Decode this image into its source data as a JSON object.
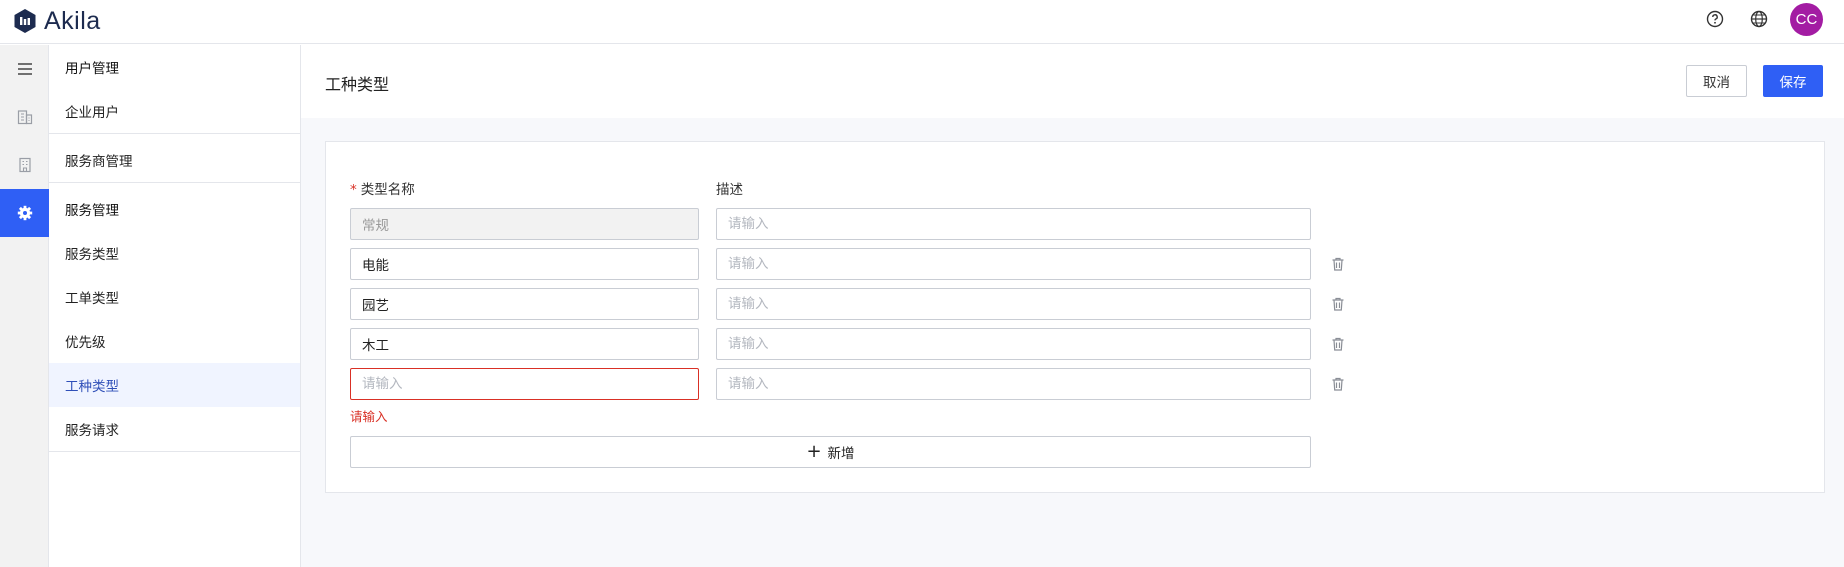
{
  "app": {
    "name": "Akila",
    "avatar_initials": "CC",
    "avatar_color": "#a31ca3",
    "accent": "#2f5ff5"
  },
  "topbar": {
    "icons": [
      "help-icon",
      "globe-icon"
    ]
  },
  "rail": {
    "items": [
      "menu-icon",
      "enterprise-building-icon",
      "building-icon",
      "settings-icon"
    ],
    "active": "settings-icon"
  },
  "sidebar": {
    "groups": [
      {
        "items": [
          "用户管理",
          "企业用户"
        ]
      },
      {
        "items": [
          "服务商管理"
        ]
      },
      {
        "items": [
          "服务管理",
          "服务类型",
          "工单类型",
          "优先级",
          "工种类型",
          "服务请求"
        ]
      }
    ],
    "active": "工种类型"
  },
  "page": {
    "title": "工种类型",
    "cancel_label": "取消",
    "save_label": "保存"
  },
  "form": {
    "name_label": "类型名称",
    "desc_label": "描述",
    "required_mark": "*",
    "rows": [
      {
        "name": "常规",
        "name_placeholder": "请输入",
        "desc_placeholder": "请输入",
        "disabled": true
      },
      {
        "name": "电能",
        "name_placeholder": "请输入",
        "desc_placeholder": "请输入"
      },
      {
        "name": "园艺",
        "name_placeholder": "请输入",
        "desc_placeholder": "请输入"
      },
      {
        "name": "木工",
        "name_placeholder": "请输入",
        "desc_placeholder": "请输入"
      },
      {
        "name": "",
        "name_placeholder": "请输入",
        "desc_placeholder": "请输入",
        "error": true
      }
    ],
    "error_message": "请输入",
    "add_label": "新增"
  }
}
